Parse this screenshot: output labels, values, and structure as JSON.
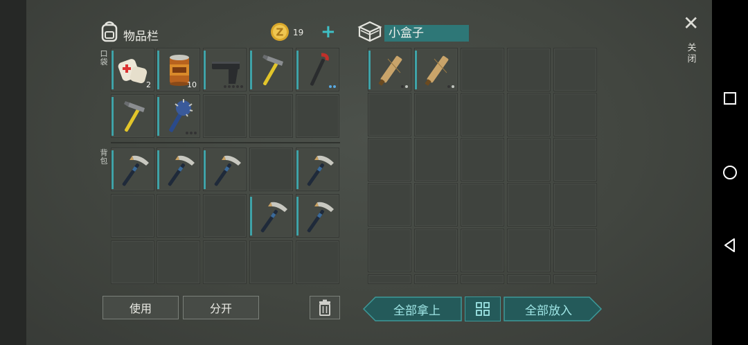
{
  "inventory": {
    "title": "物品栏",
    "coins": "19",
    "add_symbol": "+"
  },
  "pockets_label": "口袋",
  "backpack_label": "背包",
  "container": {
    "name": "小盒子"
  },
  "close": {
    "symbol": "✕",
    "label": "关闭"
  },
  "pocket_items": [
    {
      "icon": "bandage-icon",
      "count": "2",
      "durability": null
    },
    {
      "icon": "canned-food-icon",
      "count": "10",
      "durability": null
    },
    {
      "icon": "pistol-icon",
      "count": "",
      "durability": [
        0,
        0,
        0,
        0,
        0
      ]
    },
    {
      "icon": "hammer-icon",
      "count": "",
      "durability": null
    },
    {
      "icon": "crowbar-icon",
      "count": "",
      "durability": [
        2,
        2
      ]
    },
    {
      "icon": "hammer-icon",
      "count": "",
      "durability": null
    },
    {
      "icon": "spiked-club-icon",
      "count": "",
      "durability": [
        0,
        0,
        0
      ]
    }
  ],
  "backpack_items": [
    "pickaxe-icon",
    "pickaxe-icon",
    "pickaxe-icon",
    "",
    "pickaxe-icon",
    "",
    "",
    "",
    "pickaxe-icon",
    "pickaxe-icon"
  ],
  "container_items": [
    {
      "icon": "wooden-plank-icon",
      "durability": [
        0,
        1
      ]
    },
    {
      "icon": "wooden-plank-icon",
      "durability": [
        0,
        1
      ]
    }
  ],
  "buttons": {
    "use": "使用",
    "split": "分开",
    "take_all": "全部拿上",
    "put_all": "全部放入"
  }
}
